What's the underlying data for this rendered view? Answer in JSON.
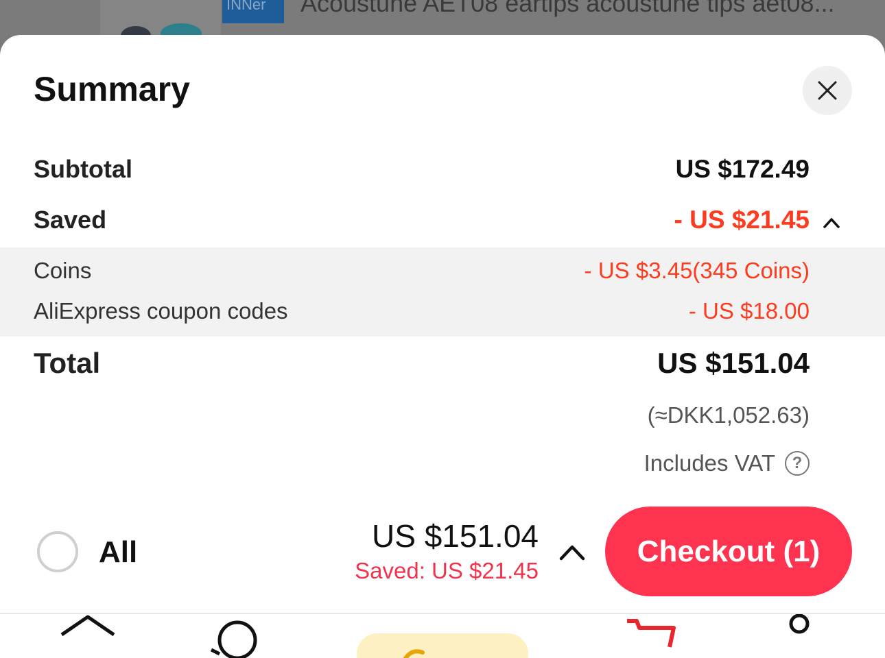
{
  "background": {
    "product_title": "Acoustune AET08 eartips acoustune tips aet08...",
    "thumb_box_text": "INNer"
  },
  "summary": {
    "title": "Summary",
    "close_icon": "close-icon"
  },
  "rows": {
    "subtotal": {
      "label": "Subtotal",
      "value": "US $172.49"
    },
    "saved": {
      "label": "Saved",
      "value": "- US $21.45",
      "expanded": true
    },
    "breakdown": [
      {
        "label": "Coins",
        "value": "- US $3.45(345 Coins)"
      },
      {
        "label": "AliExpress coupon codes",
        "value": "- US $18.00"
      }
    ],
    "total": {
      "label": "Total",
      "value": "US $151.04"
    },
    "converted": "(≈DKK1,052.63)",
    "vat_note": "Includes VAT"
  },
  "footer": {
    "all_label": "All",
    "total": "US $151.04",
    "saved": "Saved: US $21.45",
    "checkout_label": "Checkout (1)"
  },
  "tabbar": {
    "items": [
      "home-icon",
      "search-icon",
      "choice-icon",
      "cart-icon",
      "account-icon"
    ]
  },
  "colors": {
    "accent_red": "#fd3b1f",
    "checkout_pink": "#fe3350",
    "saved_pink": "#f1344d",
    "cart_red": "#e8262d"
  }
}
